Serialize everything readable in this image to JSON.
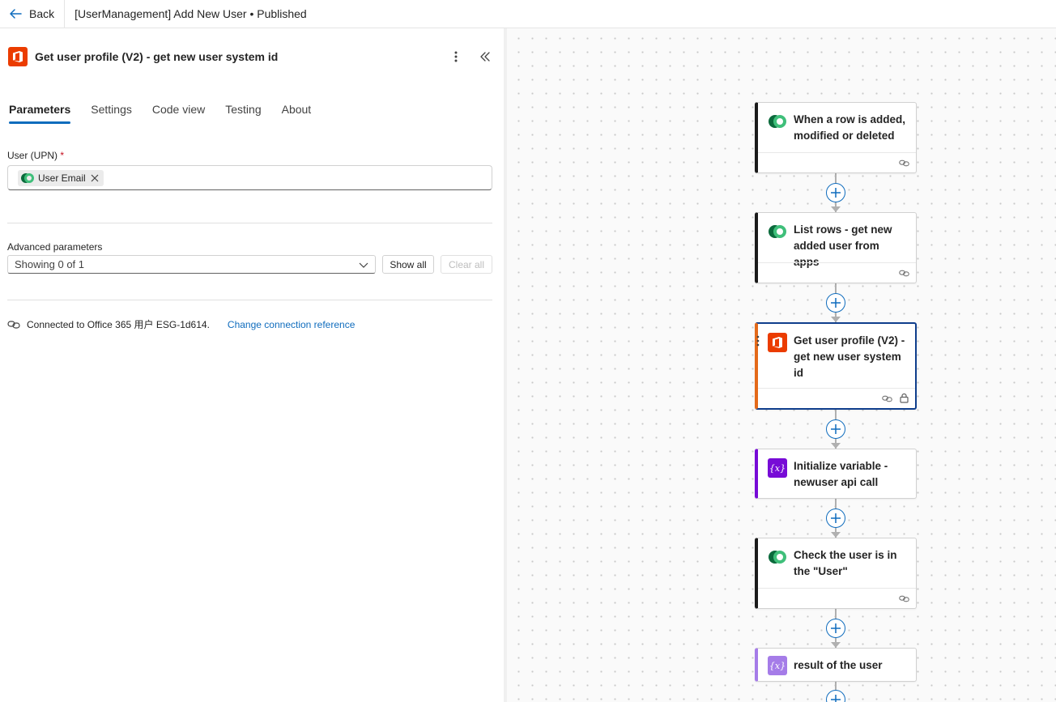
{
  "topbar": {
    "back_label": "Back",
    "flow_title": "[UserManagement] Add New User • Published"
  },
  "panel": {
    "title": "Get user profile (V2) - get new user system id",
    "tabs": [
      {
        "label": "Parameters",
        "active": true
      },
      {
        "label": "Settings"
      },
      {
        "label": "Code view"
      },
      {
        "label": "Testing"
      },
      {
        "label": "About"
      }
    ],
    "user_field_label": "User (UPN)",
    "required_mark": "*",
    "token_label": "User Email",
    "advanced_label": "Advanced parameters",
    "advanced_value": "Showing 0 of 1",
    "show_all": "Show all",
    "clear_all": "Clear all",
    "connection_text": "Connected to Office 365 用户 ESG-1d614.",
    "change_connection": "Change connection reference"
  },
  "nodes": [
    {
      "title": "When a row is added, modified or deleted",
      "icon": "dataverse-icon"
    },
    {
      "title": "List rows - get new added user from apps",
      "icon": "dataverse-icon"
    },
    {
      "title": "Get user profile (V2) - get new user system id",
      "icon": "office365-icon",
      "selected": true
    },
    {
      "title": "Initialize variable - newuser api call",
      "icon": "variable-icon"
    },
    {
      "title": "Check the user is in the \"User\"",
      "icon": "dataverse-icon"
    },
    {
      "title": "result of the user",
      "icon": "variable-icon"
    }
  ],
  "variable_glyph": "{x}",
  "colors": {
    "accent": "#0f6cbd",
    "office365": "#eb3c00",
    "variable": "#770bd6",
    "selected_border": "#0f3e8c"
  }
}
